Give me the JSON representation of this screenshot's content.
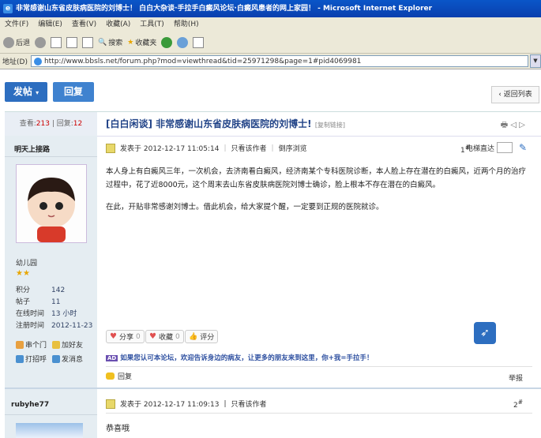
{
  "window": {
    "title": "非常感谢山东省皮肤病医院的刘博士！ 白白大杂谈·手拉手白癜风论坛·白癜风患者的网上家园！ - Microsoft Internet Explorer",
    "ie_icon": "e"
  },
  "menu": [
    "文件(F)",
    "编辑(E)",
    "查看(V)",
    "收藏(A)",
    "工具(T)",
    "帮助(H)"
  ],
  "toolbar": {
    "back": "后退",
    "search": "搜索",
    "favorites": "收藏夹"
  },
  "address": {
    "label": "地址(D)",
    "url": "http://www.bbsls.net/forum.php?mod=viewthread&tid=25971298&page=1#pid4069981"
  },
  "actions": {
    "post": "发帖",
    "reply": "回复",
    "back_list": "返回列表"
  },
  "thread": {
    "views_label": "查看:",
    "views": "213",
    "sep": " | ",
    "replies_label": "回复:",
    "replies": "12",
    "title": "[白白闲谈] 非常感谢山东省皮肤病医院的刘博士!",
    "copy_link": "[复制链接]"
  },
  "post1": {
    "username": "明天上接路",
    "group": "幼儿园",
    "stars": "★★",
    "stats": [
      {
        "k": "积分",
        "v": "142"
      },
      {
        "k": "帖子",
        "v": "11"
      },
      {
        "k": "在线时间",
        "v": "13 小时"
      },
      {
        "k": "注册时间",
        "v": "2012-11-23"
      }
    ],
    "actions": [
      "串个门",
      "加好友",
      "打招呼",
      "发消息"
    ],
    "posted": "发表于 2012-12-17 11:05:14",
    "only_author": "只看该作者",
    "reverse": "倒序浏览",
    "floor": "1",
    "floor_suffix": "#",
    "direct": "电梯直达",
    "paragraphs": [
      "本人身上有白癜风三年，一次机会，去济南看白癜风，经济南某个专科医院诊断，本人脸上存在潜在的白癜风，近两个月的治疗过程中，花了近8000元，这个周末去山东省皮肤病医院刘博士确诊，脸上根本不存在潜在的白癜风。",
      "在此，开贴非常感谢刘博士。借此机会，给大家提个醒，一定要到正规的医院就诊。"
    ],
    "share": "分享",
    "share_count": "0",
    "fav": "收藏",
    "fav_count": "0",
    "rate": "评分",
    "promo_badge": "AD",
    "promo": "如果您认可本论坛，欢迎告诉身边的病友，让更多的朋友来到这里，你+我=手拉手！",
    "reply": "回复",
    "report": "举报"
  },
  "post2": {
    "username": "rubyhe77",
    "posted": "发表于 2012-12-17 11:09:13",
    "only_author": "只看该作者",
    "floor": "2",
    "floor_suffix": "#",
    "body": "恭喜哦"
  }
}
